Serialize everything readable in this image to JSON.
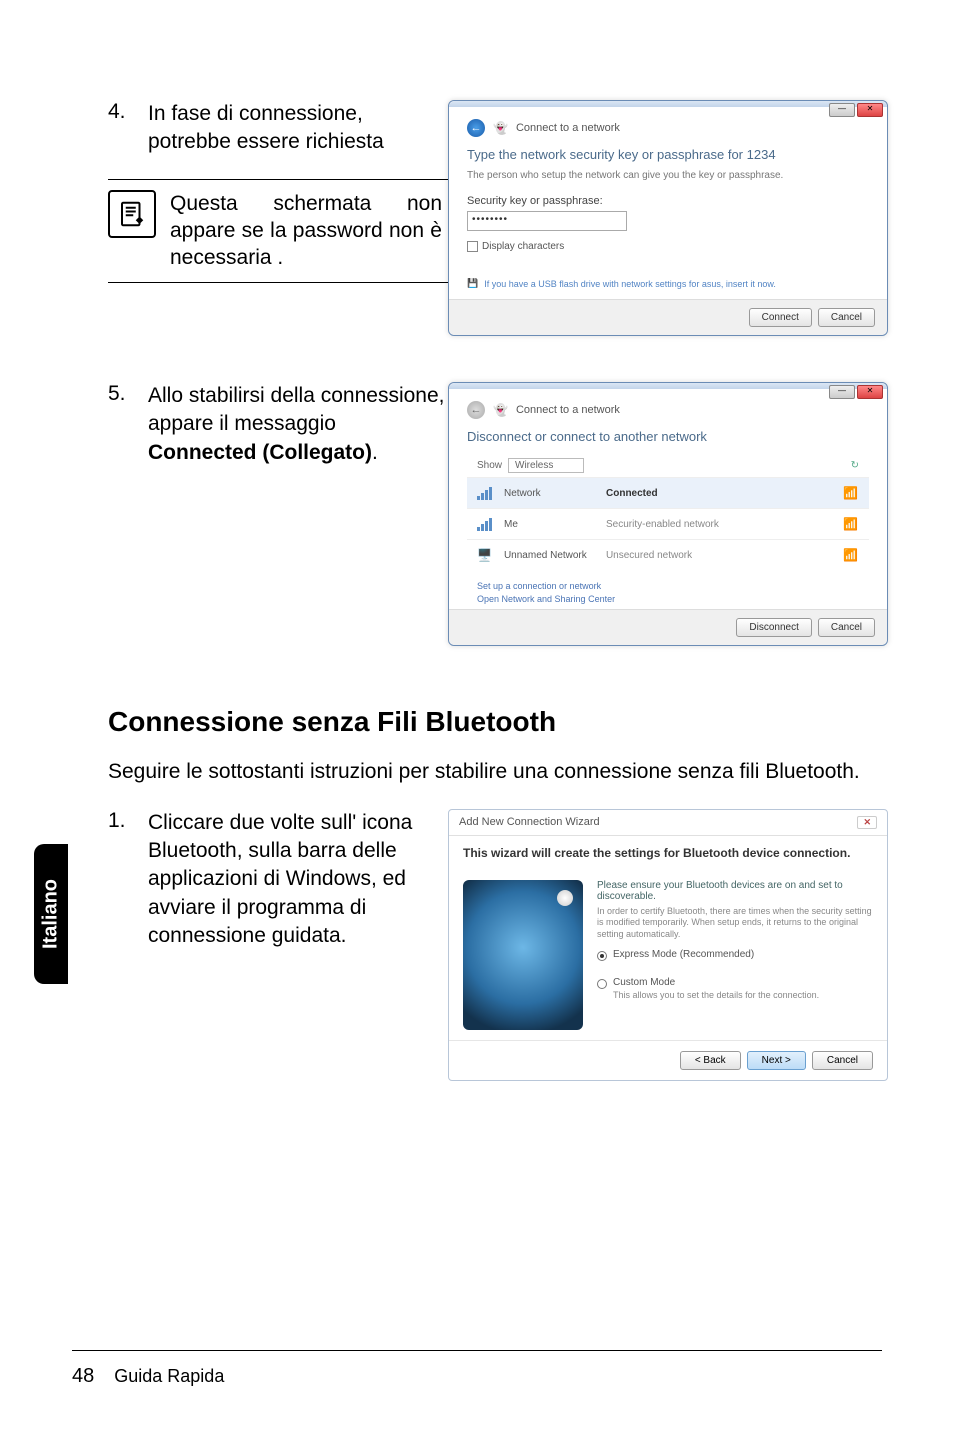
{
  "sidebar": {
    "lang": "Italiano"
  },
  "step4": {
    "num": "4.",
    "text": "In fase di connessione, potrebbe essere richiesta",
    "note": "Questa schermata non appare se la password non è necessaria ."
  },
  "dialog4": {
    "crumb": "Connect to a network",
    "title": "Type the network security key or passphrase for 1234",
    "hint": "The person who setup the network can give you the key or passphrase.",
    "label": "Security key or passphrase:",
    "value": "••••••••",
    "display_chars": "Display characters",
    "usb": "If you have a USB flash drive with network settings for asus, insert it now.",
    "btn_connect": "Connect",
    "btn_cancel": "Cancel"
  },
  "step5": {
    "num": "5.",
    "text_pre": "Allo stabilirsi della connessione, appare il messaggio ",
    "text_bold": "Connected (Collegato)",
    "text_post": "."
  },
  "dialog5": {
    "crumb": "Connect to a network",
    "title": "Disconnect or connect to another network",
    "show_label": "Show",
    "show_value": "Wireless",
    "rows": [
      {
        "name": "Network",
        "status": "Connected",
        "bars": "📶"
      },
      {
        "name": "Me",
        "status": "Security-enabled network",
        "bars": "📶"
      },
      {
        "name": "Unnamed Network",
        "status": "Unsecured network",
        "bars": "📶"
      }
    ],
    "link1": "Set up a connection or network",
    "link2": "Open Network and Sharing Center",
    "btn_disconnect": "Disconnect",
    "btn_cancel": "Cancel"
  },
  "heading": "Connessione senza Fili Bluetooth",
  "intro": "Seguire le sottostanti istruzioni per stabilire una connessione senza fili Bluetooth.",
  "step1": {
    "num": "1.",
    "text": "Cliccare due volte sull' icona Bluetooth, sulla barra delle applicazioni di Windows, ed avviare il programma di connessione guidata."
  },
  "wizard": {
    "title": "Add New Connection Wizard",
    "lead": "This wizard will create the settings for Bluetooth device connection.",
    "hdr": "Please ensure your Bluetooth devices are on and set to discoverable.",
    "tiny": "In order to certify Bluetooth, there are times when the security setting is modified temporarily. When setup ends, it returns to the original setting automatically.",
    "opt_express": "Express Mode (Recommended)",
    "opt_custom": "Custom Mode",
    "custom_hint": "This allows you to set the details for the connection.",
    "btn_back": "< Back",
    "btn_next": "Next >",
    "btn_cancel": "Cancel"
  },
  "footer": {
    "page": "48",
    "title": "Guida Rapida"
  }
}
